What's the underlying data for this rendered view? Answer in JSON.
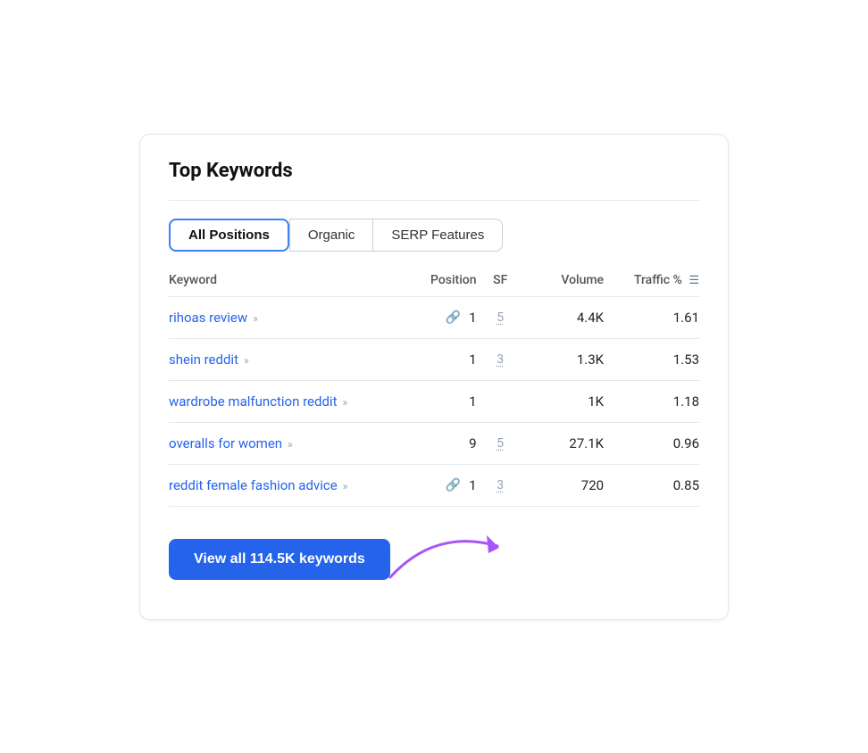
{
  "card": {
    "title": "Top Keywords",
    "tabs": [
      {
        "label": "All Positions",
        "active": true
      },
      {
        "label": "Organic",
        "active": false
      },
      {
        "label": "SERP Features",
        "active": false
      }
    ],
    "table": {
      "headers": {
        "keyword": "Keyword",
        "position": "Position",
        "sf": "SF",
        "volume": "Volume",
        "traffic": "Traffic %"
      },
      "rows": [
        {
          "keyword": "rihoas review",
          "keyword_id": "rihoas-review",
          "has_link_icon": true,
          "position": "1",
          "sf": "5",
          "volume": "4.4K",
          "traffic": "1.61"
        },
        {
          "keyword": "shein reddit",
          "keyword_id": "shein-reddit",
          "has_link_icon": false,
          "position": "1",
          "sf": "3",
          "volume": "1.3K",
          "traffic": "1.53"
        },
        {
          "keyword": "wardrobe malfunction reddit",
          "keyword_id": "wardrobe-malfunction-reddit",
          "has_link_icon": false,
          "position": "1",
          "sf": "",
          "volume": "1K",
          "traffic": "1.18"
        },
        {
          "keyword": "overalls for women",
          "keyword_id": "overalls-for-women",
          "has_link_icon": false,
          "position": "9",
          "sf": "5",
          "volume": "27.1K",
          "traffic": "0.96"
        },
        {
          "keyword": "reddit female fashion advice",
          "keyword_id": "reddit-female-fashion-advice",
          "has_link_icon": true,
          "position": "1",
          "sf": "3",
          "volume": "720",
          "traffic": "0.85"
        }
      ]
    },
    "view_button": "View all 114.5K keywords"
  }
}
